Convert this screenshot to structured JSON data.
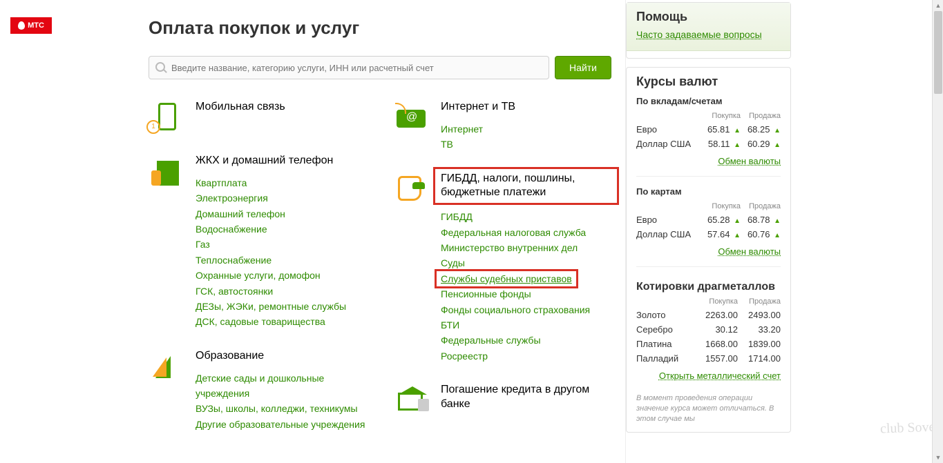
{
  "logo": "МТС",
  "page_title": "Оплата покупок и услуг",
  "search": {
    "placeholder": "Введите название, категорию услуги, ИНН или расчетный счет",
    "button": "Найти"
  },
  "left_categories": [
    {
      "icon": "mobile",
      "title": "Мобильная связь",
      "links": []
    },
    {
      "icon": "house",
      "title": "ЖКХ и домашний телефон",
      "links": [
        "Квартплата",
        "Электроэнергия",
        "Домашний телефон",
        "Водоснабжение",
        "Газ",
        "Теплоснабжение",
        "Охранные услуги, домофон",
        "ГСК, автостоянки",
        "ДЕЗы, ЖЭКи, ремонтные службы",
        "ДСК, садовые товарищества"
      ]
    },
    {
      "icon": "edu",
      "title": "Образование",
      "links": [
        "Детские сады и дошкольные учреждения",
        "ВУЗы, школы, колледжи, техникумы",
        "Другие образовательные учреждения"
      ]
    }
  ],
  "right_categories": [
    {
      "icon": "internet",
      "title": "Интернет и ТВ",
      "links": [
        "Интернет",
        "ТВ"
      ]
    },
    {
      "icon": "gov",
      "title": "ГИБДД, налоги, пошлины, бюджетные платежи",
      "highlight_title": true,
      "links": [
        "ГИБДД",
        "Федеральная налоговая служба",
        "Министерство внутренних дел",
        "Суды",
        "Службы судебных приставов",
        "Пенсионные фонды",
        "Фонды социального страхования",
        "БТИ",
        "Федеральные службы",
        "Росреестр"
      ],
      "highlight_link_index": 4
    },
    {
      "icon": "bank",
      "title": "Погашение кредита в другом банке",
      "links": []
    }
  ],
  "sidebar": {
    "help": {
      "title": "Помощь",
      "link": "Часто задаваемые вопросы"
    },
    "rates": {
      "title": "Курсы валют",
      "sub1": "По вкладам/счетам",
      "cols": [
        "Покупка",
        "Продажа"
      ],
      "deposits": [
        {
          "label": "Евро",
          "buy": "65.81",
          "sell": "68.25"
        },
        {
          "label": "Доллар США",
          "buy": "58.11",
          "sell": "60.29"
        }
      ],
      "exchange_link": "Обмен валюты",
      "sub2": "По картам",
      "cards": [
        {
          "label": "Евро",
          "buy": "65.28",
          "sell": "68.78"
        },
        {
          "label": "Доллар США",
          "buy": "57.64",
          "sell": "60.76"
        }
      ]
    },
    "metals": {
      "title": "Котировки драгметаллов",
      "cols": [
        "Покупка",
        "Продажа"
      ],
      "rows": [
        {
          "label": "Золото",
          "buy": "2263.00",
          "sell": "2493.00"
        },
        {
          "label": "Серебро",
          "buy": "30.12",
          "sell": "33.20"
        },
        {
          "label": "Платина",
          "buy": "1668.00",
          "sell": "1839.00"
        },
        {
          "label": "Палладий",
          "buy": "1557.00",
          "sell": "1714.00"
        }
      ],
      "link": "Открыть металлический счет",
      "note": "В момент проведения операции значение курса может отличаться. В этом случае мы"
    }
  },
  "watermark": "club Sovet"
}
